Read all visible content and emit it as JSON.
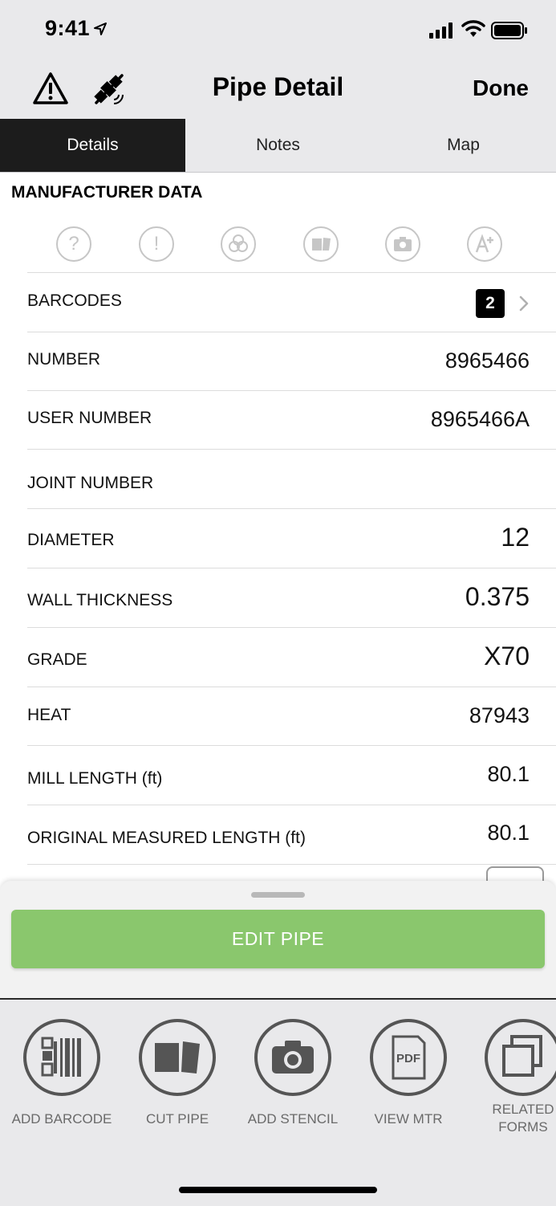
{
  "status_bar": {
    "time": "9:41"
  },
  "nav": {
    "title": "Pipe Detail",
    "done_label": "Done"
  },
  "tabs": [
    {
      "label": "Details",
      "active": true
    },
    {
      "label": "Notes",
      "active": false
    },
    {
      "label": "Map",
      "active": false
    }
  ],
  "section": {
    "header": "MANUFACTURER DATA"
  },
  "status_icons": [
    "question-icon",
    "exclamation-icon",
    "biohazard-icon",
    "cut-pipe-icon",
    "camera-icon",
    "grade-plus-icon"
  ],
  "barcodes": {
    "label": "BARCODES",
    "count": "2"
  },
  "fields": [
    {
      "label": "NUMBER",
      "value": "8965466"
    },
    {
      "label": "USER NUMBER",
      "value": "8965466A"
    },
    {
      "label": "JOINT NUMBER",
      "value": ""
    },
    {
      "label": "DIAMETER",
      "value": "12"
    },
    {
      "label": "WALL THICKNESS",
      "value": "0.375"
    },
    {
      "label": "GRADE",
      "value": "X70"
    },
    {
      "label": "HEAT",
      "value": "87943"
    },
    {
      "label": "MILL LENGTH (ft)",
      "value": "80.1"
    },
    {
      "label": "ORIGINAL MEASURED LENGTH (ft)",
      "value": "80.1"
    }
  ],
  "sheet": {
    "edit_label": "EDIT PIPE"
  },
  "toolbar": {
    "items": [
      {
        "label": "ADD BARCODE"
      },
      {
        "label": "CUT PIPE"
      },
      {
        "label": "ADD STENCIL"
      },
      {
        "label": "VIEW MTR"
      },
      {
        "label": "RELATED FORMS"
      }
    ],
    "pdf_text": "PDF"
  },
  "colors": {
    "accent_green": "#8ac76d",
    "active_tab": "#1c1c1c",
    "bar_bg": "#e9e9eb",
    "icon_grey": "#555555"
  }
}
